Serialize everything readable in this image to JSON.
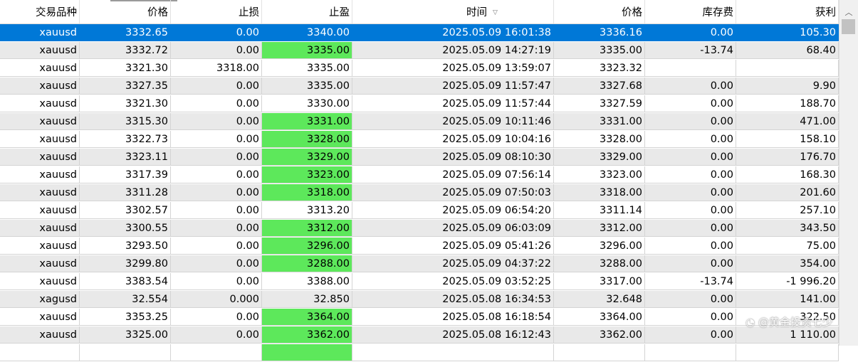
{
  "columns": [
    {
      "key": "symbol",
      "label": "交易品种"
    },
    {
      "key": "price",
      "label": "价格"
    },
    {
      "key": "sl",
      "label": "止损"
    },
    {
      "key": "tp",
      "label": "止盈"
    },
    {
      "key": "time",
      "label": "时间"
    },
    {
      "key": "close_price",
      "label": "价格"
    },
    {
      "key": "swap",
      "label": "库存费"
    },
    {
      "key": "profit",
      "label": "获利"
    }
  ],
  "sort_indicator": "▽",
  "selected_row": 0,
  "rows": [
    {
      "symbol": "xauusd",
      "price": "3332.65",
      "sl": "0.00",
      "tp": "3340.00",
      "tp_hit": false,
      "time": "2025.05.09 16:01:38",
      "close_price": "3336.16",
      "swap": "0.00",
      "profit": "105.30"
    },
    {
      "symbol": "xauusd",
      "price": "3332.72",
      "sl": "0.00",
      "tp": "3335.00",
      "tp_hit": true,
      "time": "2025.05.09 14:27:19",
      "close_price": "3335.00",
      "swap": "-13.74",
      "profit": "68.40"
    },
    {
      "symbol": "xauusd",
      "price": "3321.30",
      "sl": "3318.00",
      "tp": "3335.00",
      "tp_hit": false,
      "time": "2025.05.09 13:59:07",
      "close_price": "3323.32",
      "swap": "",
      "profit": ""
    },
    {
      "symbol": "xauusd",
      "price": "3327.35",
      "sl": "0.00",
      "tp": "3335.00",
      "tp_hit": false,
      "time": "2025.05.09 11:57:47",
      "close_price": "3327.68",
      "swap": "0.00",
      "profit": "9.90"
    },
    {
      "symbol": "xauusd",
      "price": "3321.30",
      "sl": "0.00",
      "tp": "3330.00",
      "tp_hit": false,
      "time": "2025.05.09 11:57:44",
      "close_price": "3327.59",
      "swap": "0.00",
      "profit": "188.70"
    },
    {
      "symbol": "xauusd",
      "price": "3315.30",
      "sl": "0.00",
      "tp": "3331.00",
      "tp_hit": true,
      "time": "2025.05.09 10:11:46",
      "close_price": "3331.00",
      "swap": "0.00",
      "profit": "471.00"
    },
    {
      "symbol": "xauusd",
      "price": "3322.73",
      "sl": "0.00",
      "tp": "3328.00",
      "tp_hit": true,
      "time": "2025.05.09 10:04:16",
      "close_price": "3328.00",
      "swap": "0.00",
      "profit": "158.10"
    },
    {
      "symbol": "xauusd",
      "price": "3323.11",
      "sl": "0.00",
      "tp": "3329.00",
      "tp_hit": true,
      "time": "2025.05.09 08:10:30",
      "close_price": "3329.00",
      "swap": "0.00",
      "profit": "176.70"
    },
    {
      "symbol": "xauusd",
      "price": "3317.39",
      "sl": "0.00",
      "tp": "3323.00",
      "tp_hit": true,
      "time": "2025.05.09 07:56:14",
      "close_price": "3323.00",
      "swap": "0.00",
      "profit": "168.30"
    },
    {
      "symbol": "xauusd",
      "price": "3311.28",
      "sl": "0.00",
      "tp": "3318.00",
      "tp_hit": true,
      "time": "2025.05.09 07:50:03",
      "close_price": "3318.00",
      "swap": "0.00",
      "profit": "201.60"
    },
    {
      "symbol": "xauusd",
      "price": "3302.57",
      "sl": "0.00",
      "tp": "3313.20",
      "tp_hit": false,
      "time": "2025.05.09 06:54:20",
      "close_price": "3311.14",
      "swap": "0.00",
      "profit": "257.10"
    },
    {
      "symbol": "xauusd",
      "price": "3300.55",
      "sl": "0.00",
      "tp": "3312.00",
      "tp_hit": true,
      "time": "2025.05.09 06:03:09",
      "close_price": "3312.00",
      "swap": "0.00",
      "profit": "343.50"
    },
    {
      "symbol": "xauusd",
      "price": "3293.50",
      "sl": "0.00",
      "tp": "3296.00",
      "tp_hit": true,
      "time": "2025.05.09 05:41:26",
      "close_price": "3296.00",
      "swap": "0.00",
      "profit": "75.00"
    },
    {
      "symbol": "xauusd",
      "price": "3299.80",
      "sl": "0.00",
      "tp": "3288.00",
      "tp_hit": true,
      "time": "2025.05.09 04:37:22",
      "close_price": "3288.00",
      "swap": "0.00",
      "profit": "354.00"
    },
    {
      "symbol": "xauusd",
      "price": "3383.54",
      "sl": "0.00",
      "tp": "3388.00",
      "tp_hit": false,
      "time": "2025.05.09 03:52:25",
      "close_price": "3317.00",
      "swap": "-13.74",
      "profit": "-1 996.20"
    },
    {
      "symbol": "xagusd",
      "price": "32.554",
      "sl": "0.000",
      "tp": "32.850",
      "tp_hit": false,
      "time": "2025.05.08 16:34:53",
      "close_price": "32.648",
      "swap": "0.00",
      "profit": "141.00"
    },
    {
      "symbol": "xauusd",
      "price": "3353.25",
      "sl": "0.00",
      "tp": "3364.00",
      "tp_hit": true,
      "time": "2025.05.08 16:18:54",
      "close_price": "3364.00",
      "swap": "0.00",
      "profit": "322.50"
    },
    {
      "symbol": "xauusd",
      "price": "3325.00",
      "sl": "0.00",
      "tp": "3362.00",
      "tp_hit": true,
      "time": "2025.05.08 16:12:43",
      "close_price": "3362.00",
      "swap": "0.00",
      "profit": "1 110.00"
    },
    {
      "symbol": "",
      "price": "",
      "sl": "",
      "tp": "",
      "tp_hit": true,
      "time": "",
      "close_price": "",
      "swap": "",
      "profit": ""
    }
  ],
  "colors": {
    "selected_bg": "#0078d7",
    "alt_row_bg": "#e9e9e9",
    "tp_hit_bg": "#5de85b"
  },
  "watermark": "@黄金投资七少",
  "watermark_icon": "weibo-logo"
}
